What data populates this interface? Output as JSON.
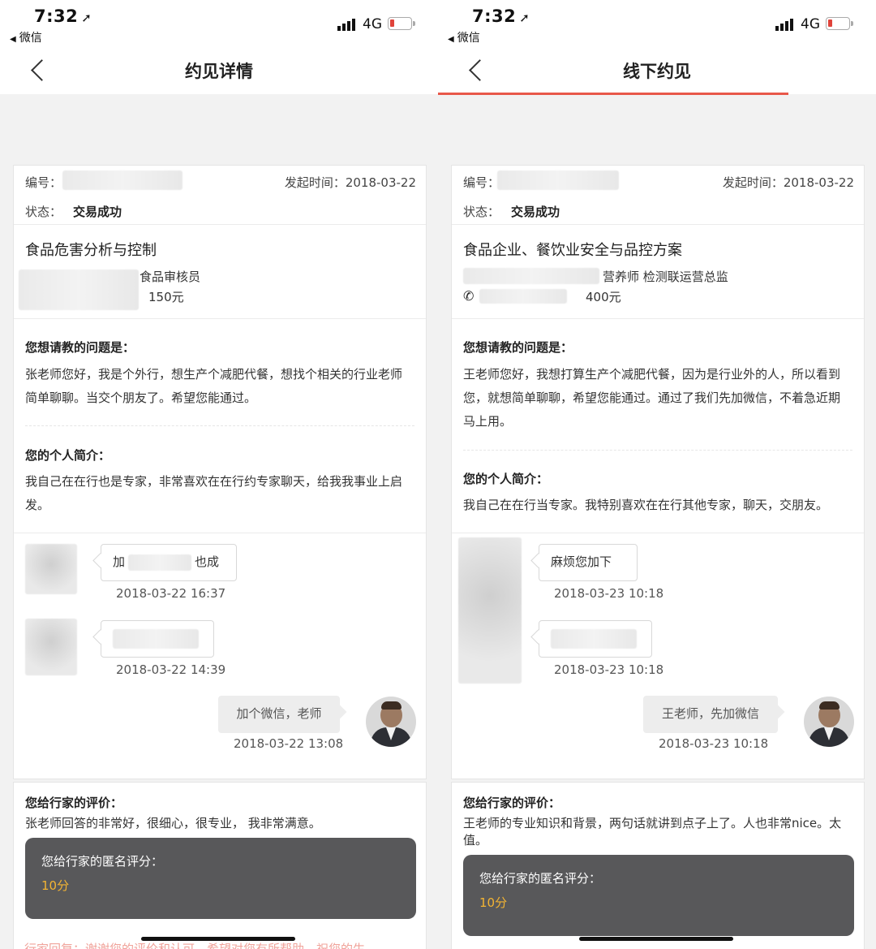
{
  "status_bar": {
    "time": "7:32",
    "back_app": "微信",
    "network": "4G"
  },
  "screens": [
    {
      "nav_title": "约见详情",
      "order_label": "编号：",
      "time_label": "发起时间：2018-03-22",
      "status_label": "状态：",
      "status_value": "交易成功",
      "course_title": "食品危害分析与控制",
      "expert_role": "食品审核员",
      "price": "150元",
      "question_title": "您想请教的问题是：",
      "question_text": "张老师您好，我是个外行，想生产个减肥代餐，想找个相关的行业老师简单聊聊。当交个朋友了。希望您能通过。",
      "intro_title": "您的个人简介：",
      "intro_text": "我自己在在行也是专家，非常喜欢在在行约专家聊天，给我我事业上启发。",
      "messages": [
        {
          "text_before": "加",
          "text_after": "也成",
          "time": "2018-03-22 16:37"
        },
        {
          "time": "2018-03-22 14:39"
        },
        {
          "text": "加个微信，老师",
          "time": "2018-03-22 13:08"
        }
      ],
      "rating_title": "您给行家的评价：",
      "rating_text": "张老师回答的非常好，很细心，很专业， 我非常满意。",
      "score_label": "您给行家的匿名评分：",
      "score_value": "10分",
      "footer_text": "行家回复：谢谢您的评价和认可，希望对您有所帮助，祝您的生"
    },
    {
      "nav_title": "线下约见",
      "order_label": "编号：",
      "time_label": "发起时间：2018-03-22",
      "status_label": "状态：",
      "status_value": "交易成功",
      "course_title": "食品企业、餐饮业安全与品控方案",
      "expert_role": "营养师 检测联运营总监",
      "price": "400元",
      "question_title": "您想请教的问题是：",
      "question_text": "王老师您好，我想打算生产个减肥代餐，因为是行业外的人，所以看到您，就想简单聊聊，希望您能通过。通过了我们先加微信，不着急近期马上用。",
      "intro_title": "您的个人简介：",
      "intro_text": "我自己在在行当专家。我特别喜欢在在行其他专家，聊天，交朋友。",
      "messages": [
        {
          "text": "麻烦您加下",
          "time": "2018-03-23 10:18"
        },
        {
          "time": "2018-03-23 10:18"
        },
        {
          "text": "王老师，先加微信",
          "time": "2018-03-23 10:18"
        }
      ],
      "rating_title": "您给行家的评价：",
      "rating_text": "王老师的专业知识和背景，两句话就讲到点子上了。人也非常nice。太值。",
      "score_label": "您给行家的匿名评分：",
      "score_value": "10分"
    }
  ],
  "colors": {
    "accent": "#e8584a",
    "score": "#f3b433",
    "score_box": "#58585a",
    "background": "#f2f2f2"
  },
  "icons": [
    "back-chevron-icon",
    "signal-icon",
    "battery-icon",
    "location-arrow-icon",
    "phone-icon"
  ]
}
